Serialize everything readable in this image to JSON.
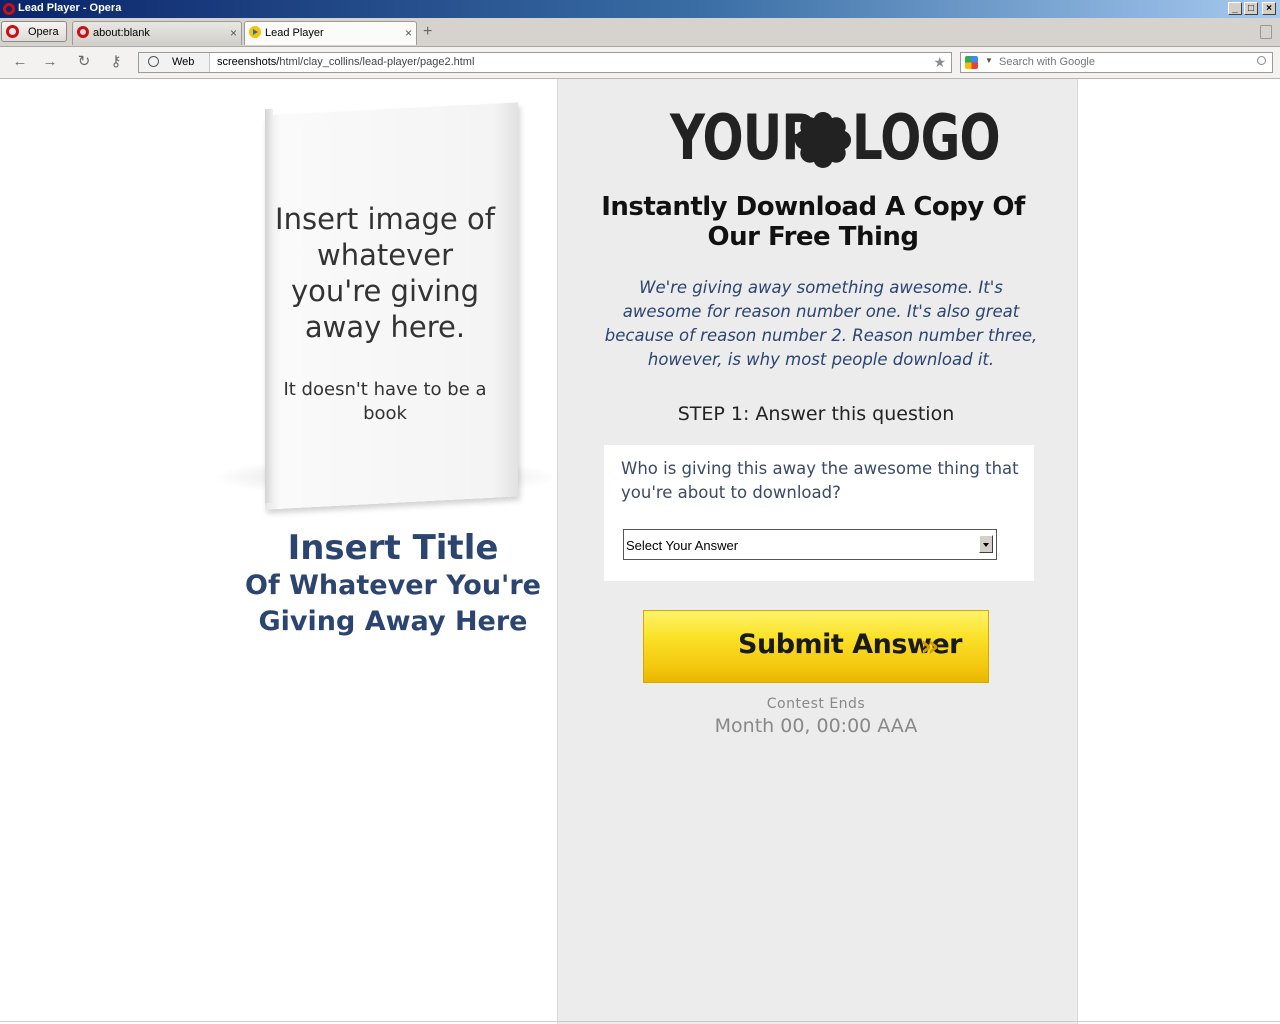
{
  "window": {
    "title": "Lead Player - Opera",
    "controls": [
      "_",
      "□",
      "×"
    ]
  },
  "tabbar": {
    "menu_label": "Opera",
    "tabs": [
      {
        "label": "about:blank",
        "close": "×"
      },
      {
        "label": "Lead Player",
        "close": "×"
      }
    ],
    "new_tab": "+"
  },
  "navbar": {
    "back": "←",
    "forward": "→",
    "reload": "↻",
    "key": "⚷",
    "web_badge": "Web",
    "url_prefix": "screenshots/",
    "url_rest": "html/clay_collins/lead-player/page2.html",
    "star": "★",
    "search_placeholder": "Search with Google"
  },
  "left": {
    "book_main": "Insert image of whatever you're giving away here.",
    "book_sub": "It doesn't have to be a book",
    "title_line1": "Insert Title",
    "title_line2": "Of Whatever You're Giving Away Here"
  },
  "right": {
    "logo_left": "YOUR",
    "logo_right": "LOGO",
    "headline": "Instantly Download A Copy Of Our Free Thing",
    "blurb": "We're giving away something awesome. It's awesome for reason number one. It's also great because of reason number 2. Reason number three, however, is why most people download it.",
    "step": "STEP 1: Answer this question",
    "question": "Who is giving this away the awesome thing that you're about to download?",
    "select_value": "Select Your Answer",
    "submit_label": "Submit Answer",
    "submit_chevrons": "»",
    "contest_label": "Contest Ends",
    "contest_date": "Month 00, 00:00 AAA"
  },
  "colors": {
    "title_accent": "#2b4470",
    "button_yellow": "#f3c70d",
    "panel_bg": "#ececec"
  }
}
